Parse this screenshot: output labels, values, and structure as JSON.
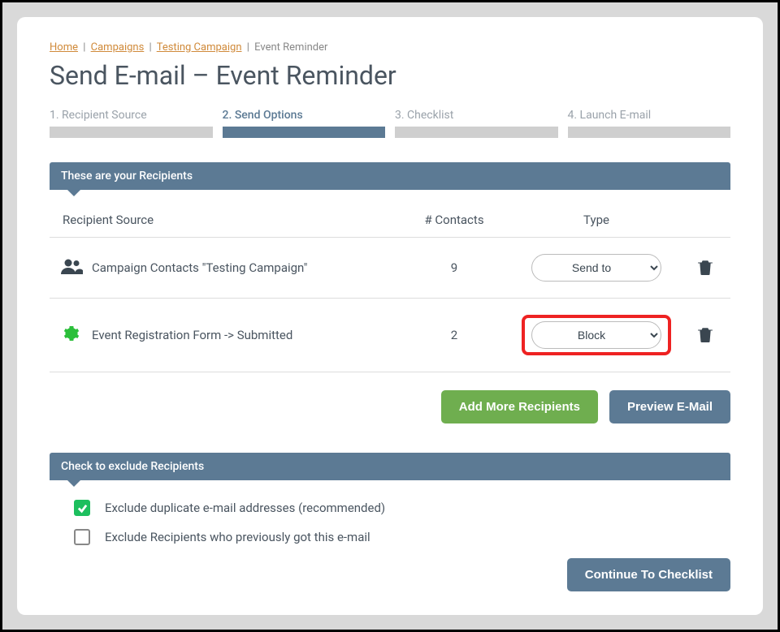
{
  "breadcrumb": {
    "home": "Home",
    "campaigns": "Campaigns",
    "campaign": "Testing Campaign",
    "current": "Event Reminder"
  },
  "page_title": "Send E-mail – Event Reminder",
  "steps": [
    {
      "label": "1. Recipient Source",
      "active": false
    },
    {
      "label": "2. Send Options",
      "active": true
    },
    {
      "label": "3. Checklist",
      "active": false
    },
    {
      "label": "4. Launch E-mail",
      "active": false
    }
  ],
  "recipients_section_title": "These are your Recipients",
  "table": {
    "headers": {
      "source": "Recipient Source",
      "contacts": "# Contacts",
      "type": "Type"
    },
    "rows": [
      {
        "icon": "people",
        "source": "Campaign Contacts \"Testing Campaign\"",
        "contacts": "9",
        "type_selected": "Send to",
        "highlighted": false
      },
      {
        "icon": "gear",
        "source": "Event Registration Form -> Submitted",
        "contacts": "2",
        "type_selected": "Block",
        "highlighted": true
      }
    ],
    "type_options": [
      "Send to",
      "Block"
    ]
  },
  "buttons": {
    "add_more": "Add More Recipients",
    "preview": "Preview E-Mail",
    "continue": "Continue To Checklist"
  },
  "exclude_section_title": "Check to exclude Recipients",
  "exclude_options": [
    {
      "label": "Exclude duplicate e-mail addresses (recommended)",
      "checked": true
    },
    {
      "label": "Exclude Recipients who previously got this e-mail",
      "checked": false
    }
  ]
}
